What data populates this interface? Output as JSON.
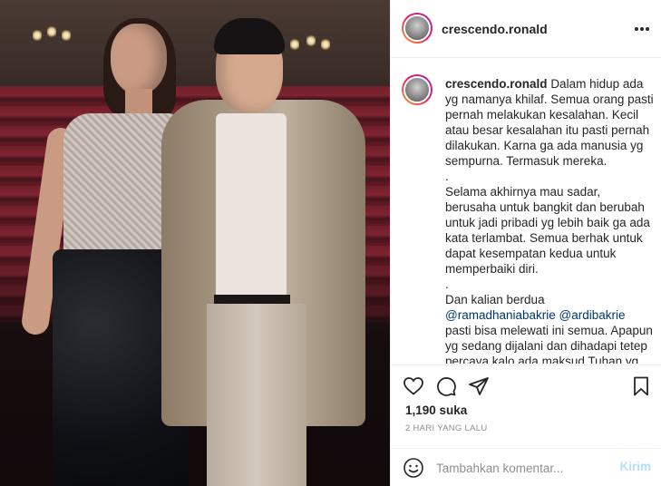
{
  "post": {
    "username": "crescendo.ronald",
    "caption": {
      "username": "crescendo.ronald",
      "paragraphs": [
        "Dalam hidup ada yg namanya khilaf. Semua orang pasti pernah melakukan kesalahan. Kecil atau besar kesalahan itu pasti pernah dilakukan. Karna ga ada manusia yg sempurna. Termasuk mereka.",
        ".",
        "Selama akhirnya mau sadar, berusaha untuk bangkit dan berubah untuk jadi pribadi yg lebih baik ga ada kata terlambat. Semua berhak untuk dapat kesempatan kedua untuk memperbaiki diri.",
        ".",
        "Dan kalian berdua"
      ],
      "mention_1": "@ramadhaniabakrie",
      "mention_2": "@ardibakrie",
      "tail": "pasti bisa melewati ini semua. Apapun yg sedang dijalani dan dihadapi tetep percaya kalo ada maksud Tuhan yg baik didalamnya. Stay strong ya"
    },
    "likes": "1,190 suka",
    "timestamp": "2 HARI YANG LALU",
    "comment": {
      "placeholder": "Tambahkan komentar...",
      "post_label": "Kirim"
    },
    "icons": {
      "like": "heart-icon",
      "comment": "comment-icon",
      "share": "share-icon",
      "save": "bookmark-icon",
      "more": "more-icon",
      "emoji": "emoji-icon"
    }
  }
}
